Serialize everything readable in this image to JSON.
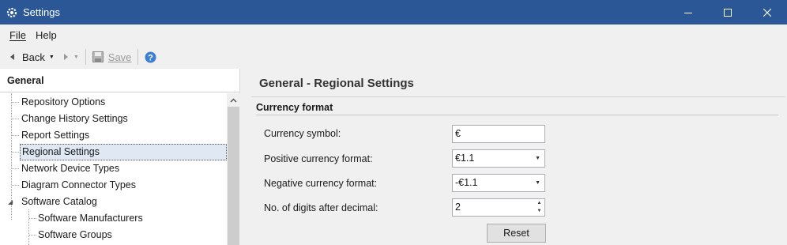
{
  "window": {
    "title": "Settings"
  },
  "menu": {
    "file": "File",
    "help": "Help"
  },
  "toolbar": {
    "back_label": "Back",
    "save_label": "Save"
  },
  "sidebar": {
    "header": "General",
    "items": [
      {
        "label": "Repository Options"
      },
      {
        "label": "Change History Settings"
      },
      {
        "label": "Report Settings"
      },
      {
        "label": "Regional Settings"
      },
      {
        "label": "Network Device Types"
      },
      {
        "label": "Diagram Connector Types"
      },
      {
        "label": "Software Catalog"
      },
      {
        "label": "Software Manufacturers"
      },
      {
        "label": "Software Groups"
      }
    ]
  },
  "main": {
    "title": "General - Regional Settings",
    "section": "Currency format",
    "fields": [
      {
        "label": "Currency symbol:",
        "value": "€"
      },
      {
        "label": "Positive currency format:",
        "value": "€1.1"
      },
      {
        "label": "Negative currency format:",
        "value": "-€1.1"
      },
      {
        "label": "No. of digits after decimal:",
        "value": "2"
      }
    ],
    "reset_label": "Reset"
  },
  "colors": {
    "titlebar": "#2b5797",
    "selection": "#dfe8f3"
  }
}
